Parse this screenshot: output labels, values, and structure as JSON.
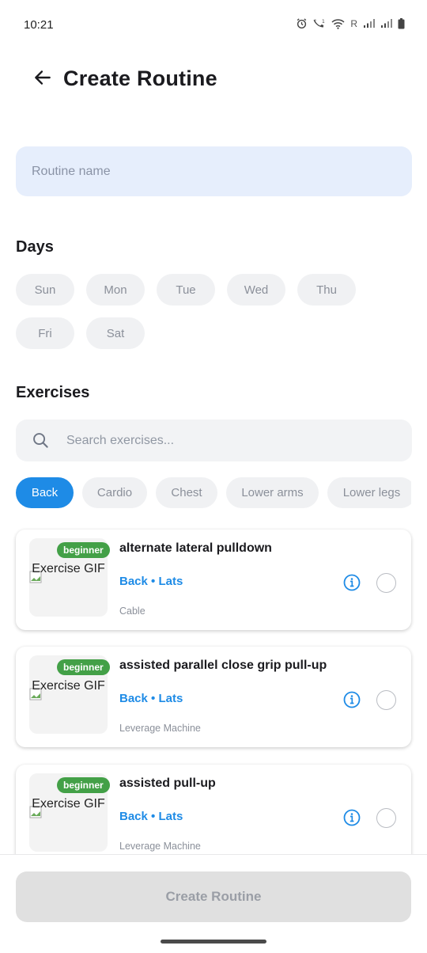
{
  "status_bar": {
    "time": "10:21",
    "carrier_letter": "R"
  },
  "header": {
    "title": "Create Routine",
    "back_icon": "arrow-left-icon"
  },
  "routine_name": {
    "placeholder": "Routine name",
    "value": ""
  },
  "days": {
    "title": "Days",
    "items": [
      "Sun",
      "Mon",
      "Tue",
      "Wed",
      "Thu",
      "Fri",
      "Sat"
    ]
  },
  "exercises": {
    "title": "Exercises",
    "search_placeholder": "Search exercises...",
    "filters": [
      {
        "label": "Back",
        "active": true
      },
      {
        "label": "Cardio",
        "active": false
      },
      {
        "label": "Chest",
        "active": false
      },
      {
        "label": "Lower arms",
        "active": false
      },
      {
        "label": "Lower legs",
        "active": false
      }
    ],
    "items": [
      {
        "level": "beginner",
        "image_alt": "Exercise GIF",
        "name": "alternate lateral pulldown",
        "target": "Back • Lats",
        "equipment": "Cable"
      },
      {
        "level": "beginner",
        "image_alt": "Exercise GIF",
        "name": "assisted parallel close grip pull-up",
        "target": "Back • Lats",
        "equipment": "Leverage Machine"
      },
      {
        "level": "beginner",
        "image_alt": "Exercise GIF",
        "name": "assisted pull-up",
        "target": "Back • Lats",
        "equipment": "Leverage Machine"
      }
    ]
  },
  "footer": {
    "create_label": "Create Routine"
  },
  "colors": {
    "accent": "#1e8be6",
    "badge": "#43a047",
    "input_bg": "#e6eefc",
    "chip_bg": "#f0f1f3"
  }
}
